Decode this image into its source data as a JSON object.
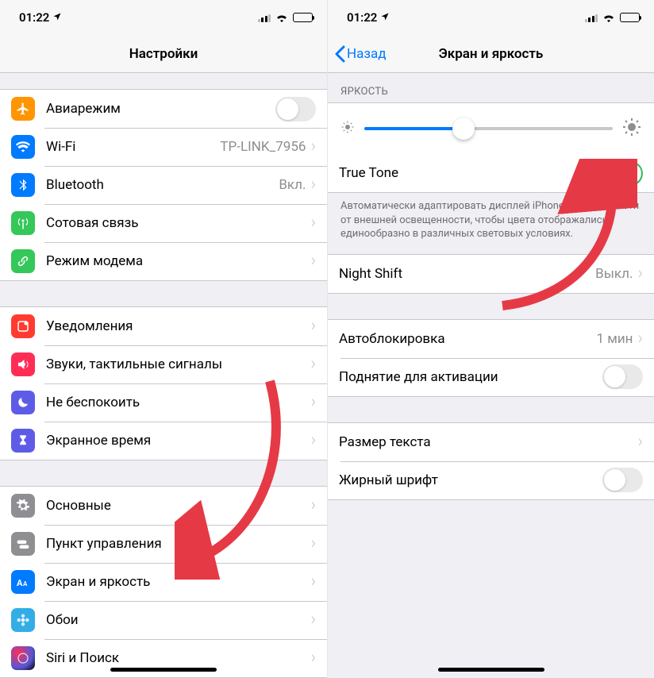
{
  "status": {
    "time": "01:22"
  },
  "left": {
    "title": "Настройки",
    "groups": [
      {
        "rows": [
          {
            "icon": "airplane-icon",
            "bg": "bg-orange",
            "label": "Авиарежим",
            "type": "toggle",
            "on": false
          },
          {
            "icon": "wifi-icon",
            "bg": "bg-blue",
            "label": "Wi-Fi",
            "type": "disclosure",
            "detail": "TP-LINK_7956"
          },
          {
            "icon": "bluetooth-icon",
            "bg": "bg-blue",
            "label": "Bluetooth",
            "type": "disclosure",
            "detail": "Вкл."
          },
          {
            "icon": "antenna-icon",
            "bg": "bg-green",
            "label": "Сотовая связь",
            "type": "disclosure"
          },
          {
            "icon": "link-icon",
            "bg": "bg-green",
            "label": "Режим модема",
            "type": "disclosure"
          }
        ]
      },
      {
        "rows": [
          {
            "icon": "bell-icon",
            "bg": "bg-red",
            "label": "Уведомления",
            "type": "disclosure"
          },
          {
            "icon": "speaker-icon",
            "bg": "bg-pink",
            "label": "Звуки, тактильные сигналы",
            "type": "disclosure"
          },
          {
            "icon": "moon-icon",
            "bg": "bg-indigo",
            "label": "Не беспокоить",
            "type": "disclosure"
          },
          {
            "icon": "hourglass-icon",
            "bg": "bg-indigo",
            "label": "Экранное время",
            "type": "disclosure"
          }
        ]
      },
      {
        "rows": [
          {
            "icon": "gear-icon",
            "bg": "bg-gray",
            "label": "Основные",
            "type": "disclosure"
          },
          {
            "icon": "switches-icon",
            "bg": "bg-gray",
            "label": "Пункт управления",
            "type": "disclosure"
          },
          {
            "icon": "textsize-icon",
            "bg": "bg-blue",
            "label": "Экран и яркость",
            "type": "disclosure"
          },
          {
            "icon": "flower-icon",
            "bg": "bg-cyan",
            "label": "Обои",
            "type": "disclosure"
          },
          {
            "icon": "siri-icon",
            "bg": "bg-grad",
            "label": "Siri и Поиск",
            "type": "disclosure"
          }
        ]
      }
    ]
  },
  "right": {
    "back": "Назад",
    "title": "Экран и яркость",
    "brightness_header": "ЯРКОСТЬ",
    "slider": {
      "value": 40
    },
    "truetone_label": "True Tone",
    "truetone_on": true,
    "truetone_footer": "Автоматически адаптировать дисплей iPhone в зависимости от внешней освещенности, чтобы цвета отображались единообразно в различных световых условиях.",
    "nightshift_label": "Night Shift",
    "nightshift_detail": "Выкл.",
    "autolock_label": "Автоблокировка",
    "autolock_detail": "1 мин",
    "raise_label": "Поднятие для активации",
    "raise_on": false,
    "textsize_label": "Размер текста",
    "bold_label": "Жирный шрифт",
    "bold_on": false
  }
}
